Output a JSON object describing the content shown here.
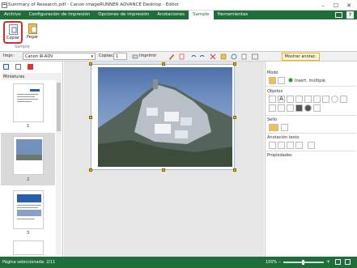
{
  "window": {
    "title": "Summary of Research.pdf - Canon imageRUNNER ADVANCE Desktop - Editor"
  },
  "ribbon_tabs": [
    "Archivo",
    "Configuración de impresión",
    "Opciones de impresión",
    "Anotaciones",
    "Sample",
    "Herramientas"
  ],
  "ribbon": {
    "copy_label": "Copiar",
    "paste_label": "Pegar",
    "group_label": "Sample"
  },
  "toolbar": {
    "printer_label": "Impr.:",
    "printer_value": "Canon iR-ADV",
    "copies_label": "Copias:",
    "copies_value": "1",
    "print_label": "Imprimir",
    "show_annotations": "Mostrar anotac."
  },
  "left_panel": {
    "header": "Miniaturas",
    "pages": [
      "1",
      "2",
      "3"
    ],
    "selected_page": "2"
  },
  "right_panel": {
    "mode_label": "Modo",
    "insert_multiple": "Insert. múltiple",
    "objects_label": "Objetos",
    "stamp_label": "Sello",
    "text_annotation_label": "Anotación texto",
    "properties_label": "Propiedades"
  },
  "status": {
    "text": "Página seleccionada: 2/11",
    "zoom": "100%"
  },
  "colors": {
    "brand_green": "#1e6e3a",
    "copy_highlight": "#d42b2b",
    "selection_handle": "#e8c200"
  }
}
